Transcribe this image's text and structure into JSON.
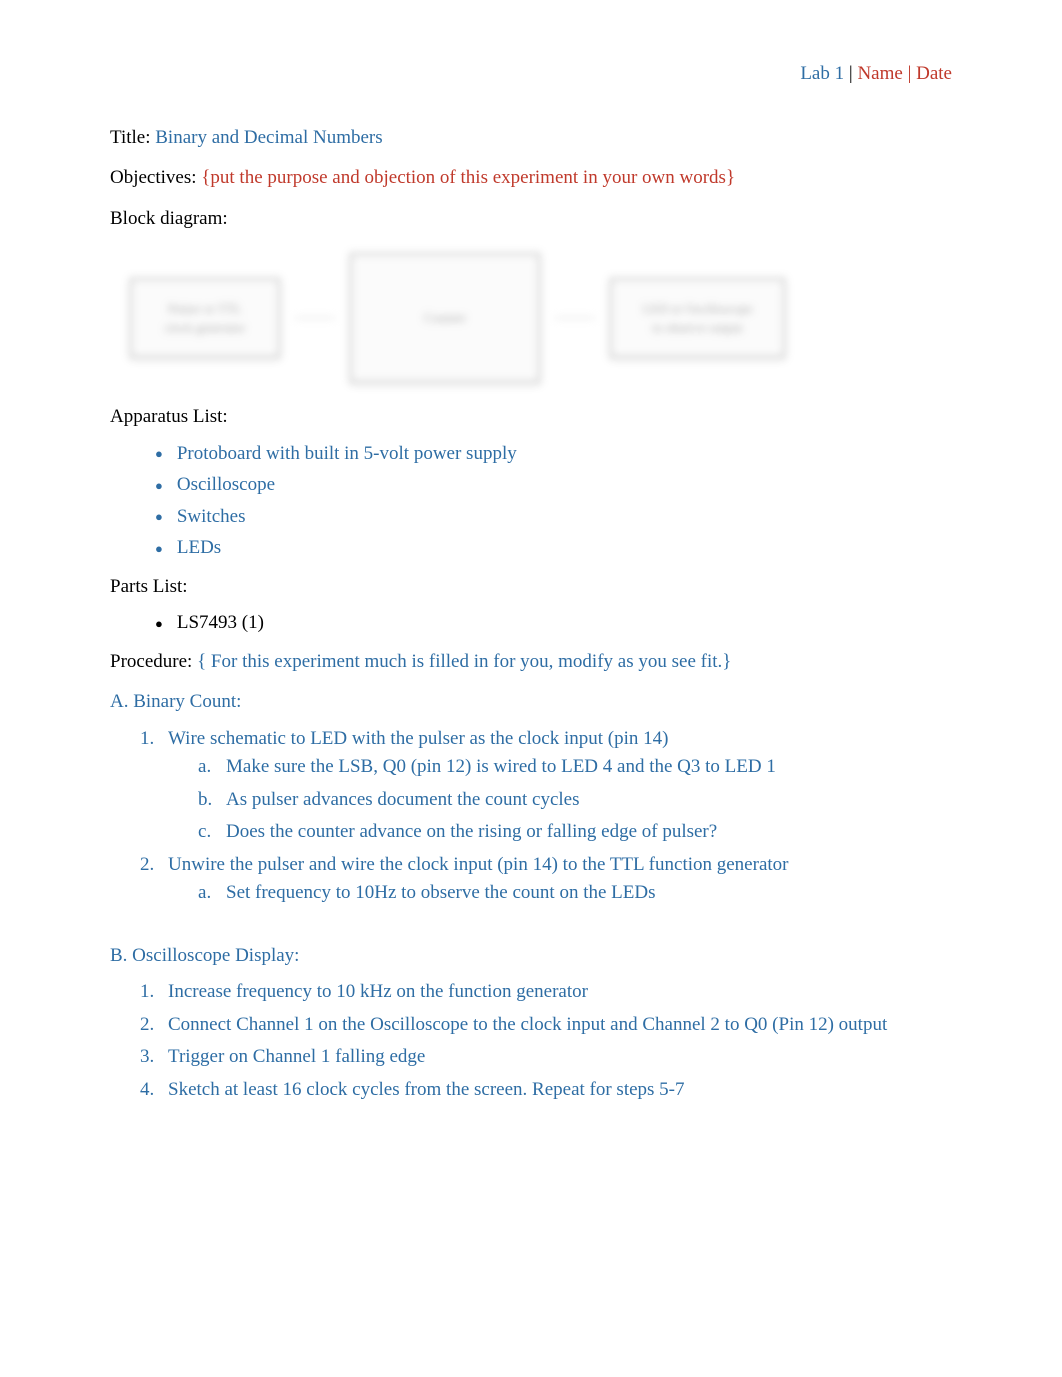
{
  "header": {
    "lab": "Lab 1",
    "sep1": " | ",
    "name": "Name",
    "sep2": " | ",
    "date": "Date"
  },
  "title": {
    "label": "Title:",
    "value": "Binary and Decimal Numbers"
  },
  "objectives": {
    "label": "Objectives:",
    "value": "{put the purpose and objection of this experiment in your own words}"
  },
  "block_diagram": {
    "label": "Block diagram:",
    "boxes": {
      "left": "Pulser or TTL clock generator",
      "middle": "Counter",
      "right": "LED or Oscilloscope to observe output"
    }
  },
  "apparatus_list": {
    "label": "Apparatus List:",
    "items": [
      "Protoboard with built in 5-volt power supply",
      "Oscilloscope",
      "Switches",
      "LEDs"
    ]
  },
  "parts_list": {
    "label": "Parts List:",
    "items": [
      "LS7493 (1)"
    ]
  },
  "procedure": {
    "label": "Procedure:",
    "note": "{ For this experiment much is filled in for you, modify as you see fit.}"
  },
  "section_a": {
    "title": "A. Binary Count:",
    "items": [
      {
        "text": "Wire schematic to LED with the pulser as the clock input (pin 14)",
        "sub": [
          "Make sure the LSB, Q0 (pin 12) is wired to LED 4 and the Q3 to LED 1",
          "As pulser advances document the count cycles",
          "Does the counter advance on the rising or falling edge of pulser?"
        ]
      },
      {
        "text": "Unwire the pulser and wire the clock input (pin 14) to the TTL function generator",
        "sub": [
          "Set frequency to 10Hz to observe the count on the LEDs"
        ]
      }
    ]
  },
  "section_b": {
    "title": "B. Oscilloscope Display:",
    "items": [
      "Increase frequency to 10 kHz on the function generator",
      "Connect Channel 1 on the Oscilloscope to the clock input and Channel 2 to Q0 (Pin 12) output",
      "Trigger on Channel 1 falling edge",
      "Sketch at least 16 clock cycles from the screen. Repeat for steps 5-7"
    ]
  }
}
